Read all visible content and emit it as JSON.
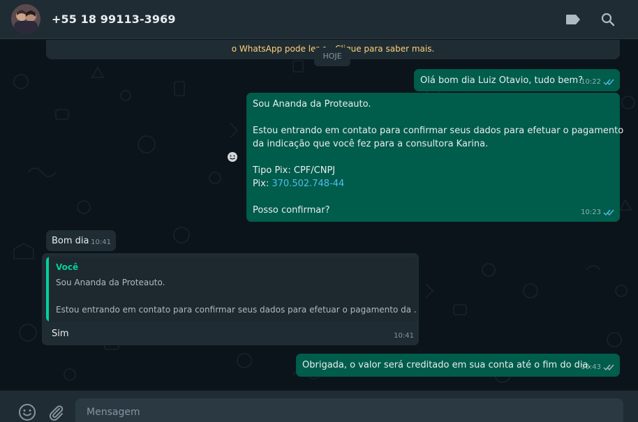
{
  "header": {
    "contact_name": "+55 18 99113-3969"
  },
  "notice": {
    "text": "o WhatsApp pode ler o                         . Clique para saber mais."
  },
  "day_chip": "HOJE",
  "messages": [
    {
      "direction": "outgoing",
      "text": "Olá bom dia Luiz Otavio, tudo bem?",
      "time": "10:22",
      "status": "read"
    },
    {
      "direction": "outgoing",
      "lines": {
        "l1": "Sou Ananda da Proteauto.",
        "l2": "Estou entrando em contato para confirmar seus dados para efetuar o pagamento",
        "l3": "da indicação que você fez para a consultora Karina.",
        "l4": "Tipo Pix: CPF/CNPJ",
        "l5_label": "Pix: ",
        "l5_value": "370.502.748-44",
        "l6": "Posso confirmar?"
      },
      "time": "10:23",
      "status": "read"
    },
    {
      "direction": "incoming",
      "text": "Bom dia",
      "time": "10:41"
    },
    {
      "direction": "incoming",
      "quote": {
        "author": "Você",
        "line1": "Sou Ananda da Proteauto.",
        "line2": "Estou entrando em contato para confirmar seus dados para efetuar o pagamento da ..."
      },
      "text": "Sim",
      "time": "10:41"
    },
    {
      "direction": "outgoing",
      "text": "Obrigada, o valor será creditado em sua conta até o fim do dia.",
      "time": "10:43",
      "status": "read"
    }
  ],
  "composer": {
    "placeholder": "Mensagem"
  },
  "icons": {
    "label": "label-icon",
    "search": "search-icon",
    "emoji": "emoji-icon",
    "attach": "paperclip-icon",
    "react": "smiley-react-icon"
  },
  "colors": {
    "outgoing_bubble": "#005c4b",
    "incoming_bubble": "#202c33",
    "accent": "#06cf9c",
    "link": "#53bdeb",
    "read_ticks": "#53bdeb"
  }
}
